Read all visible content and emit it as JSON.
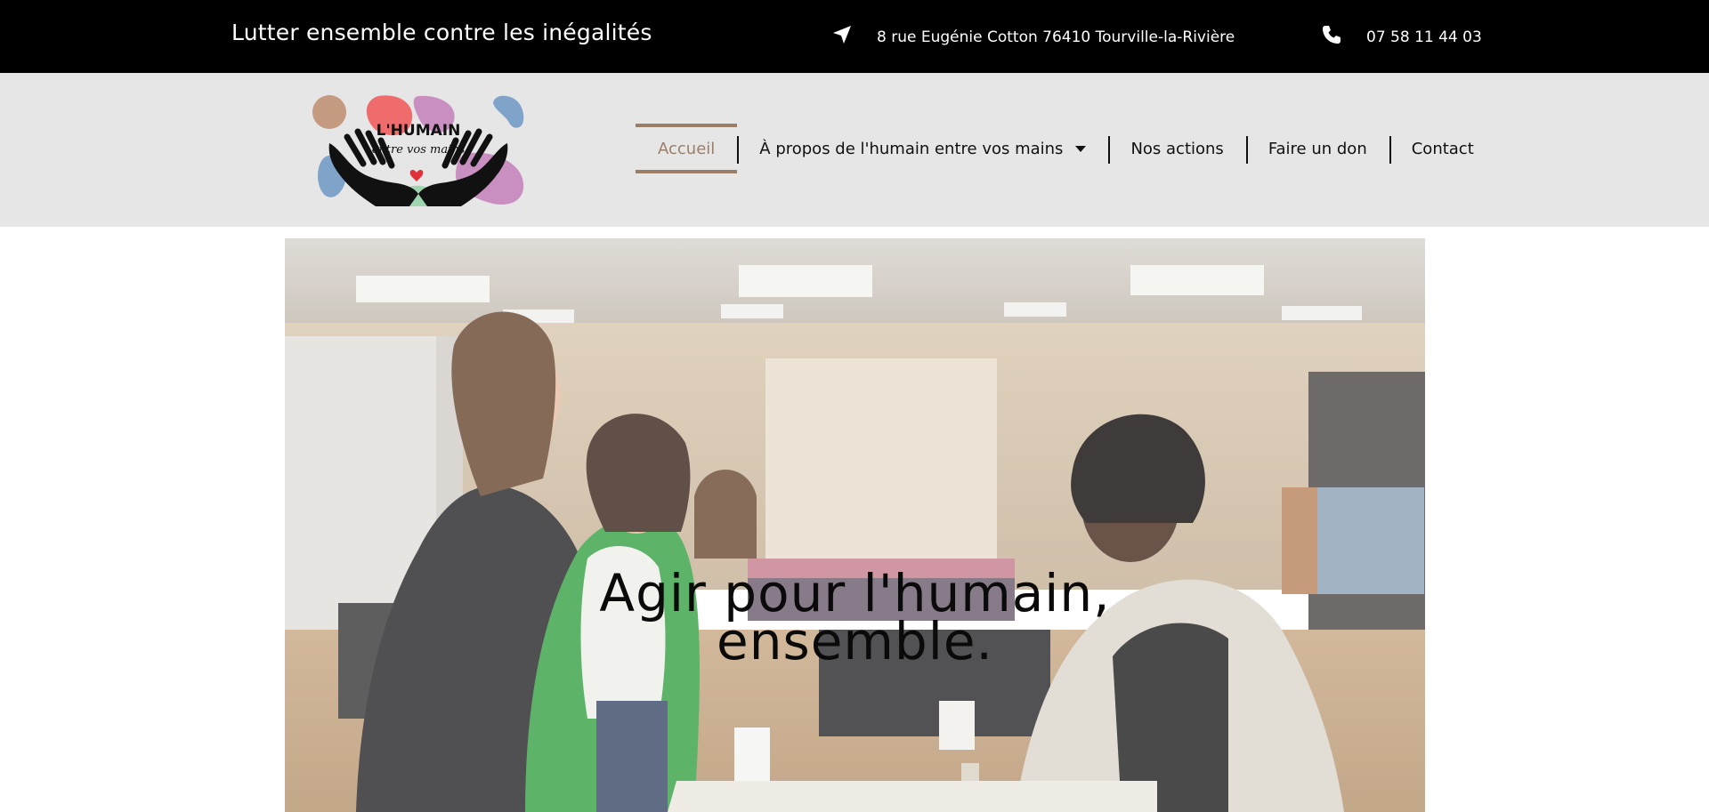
{
  "topbar": {
    "tagline": "Lutter ensemble contre les inégalités",
    "address": "8 rue Eugénie Cotton 76410 Tourville-la-Rivière",
    "address_icon": "location-arrow-icon",
    "phone": "07 58 11 44 03",
    "phone_icon": "phone-icon"
  },
  "logo": {
    "line1": "L'HUMAIN",
    "line2": "entre vos mains"
  },
  "nav": {
    "items": [
      {
        "label": "Accueil",
        "active": true
      },
      {
        "label": "À propos de l'humain entre vos mains",
        "has_dropdown": true
      },
      {
        "label": "Nos actions"
      },
      {
        "label": "Faire un don"
      },
      {
        "label": "Contact"
      }
    ]
  },
  "hero": {
    "title_line1": "Agir pour l'humain,",
    "title_line2": "ensemble."
  },
  "colors": {
    "accent": "#9a7f68",
    "topbar_bg": "#000000",
    "header_bg": "#e6e6e6"
  }
}
